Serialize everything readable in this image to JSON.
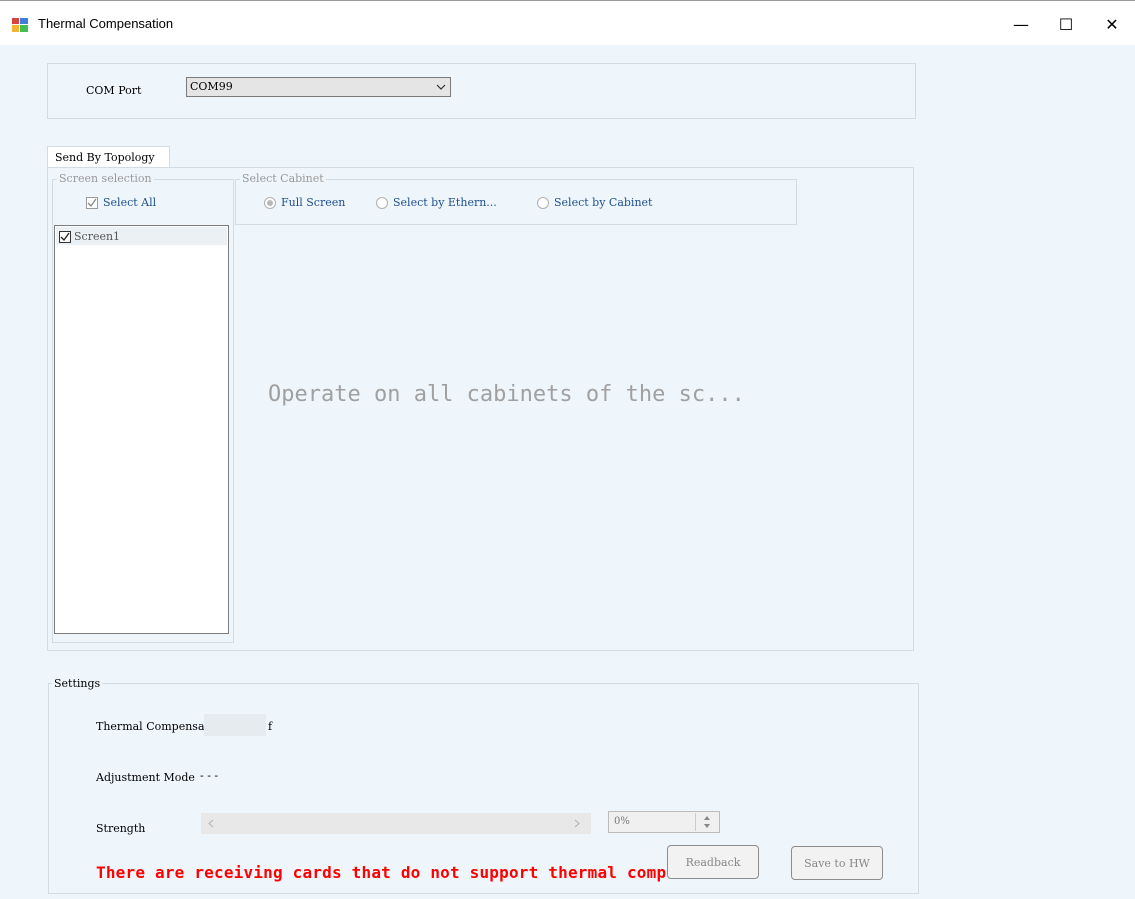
{
  "window": {
    "title": "Thermal Compensation",
    "minimize_glyph": "—",
    "maximize_glyph": "☐",
    "close_glyph": "✕"
  },
  "com_port": {
    "label": "COM Port",
    "selected": "COM99"
  },
  "tabs": [
    {
      "label": "Send By Topology"
    }
  ],
  "screen_selection": {
    "legend": "Screen selection",
    "select_all_label": "Select All",
    "select_all_checked": true,
    "screens": [
      {
        "label": "Screen1",
        "checked": true
      }
    ]
  },
  "select_cabinet": {
    "legend": "Select Cabinet",
    "options": [
      {
        "label": "Full Screen",
        "selected": true
      },
      {
        "label": "Select by Ethern...",
        "selected": false
      },
      {
        "label": "Select by Cabinet",
        "selected": false
      }
    ],
    "message": "Operate on all cabinets of the sc..."
  },
  "settings": {
    "legend": "Settings",
    "thermal_label": "Thermal Compensa",
    "thermal_suffix": "f",
    "adjustment_label": "Adjustment Mode",
    "adjustment_value": "- - -",
    "strength_label": "Strength",
    "strength_value": "0%",
    "warning": "There are receiving cards that do not support thermal comp",
    "readback_label": "Readback",
    "save_label": "Save to HW"
  },
  "colors": {
    "background": "#eef5fb",
    "warning": "#ff0000",
    "radio_text": "#1e4f8f"
  }
}
